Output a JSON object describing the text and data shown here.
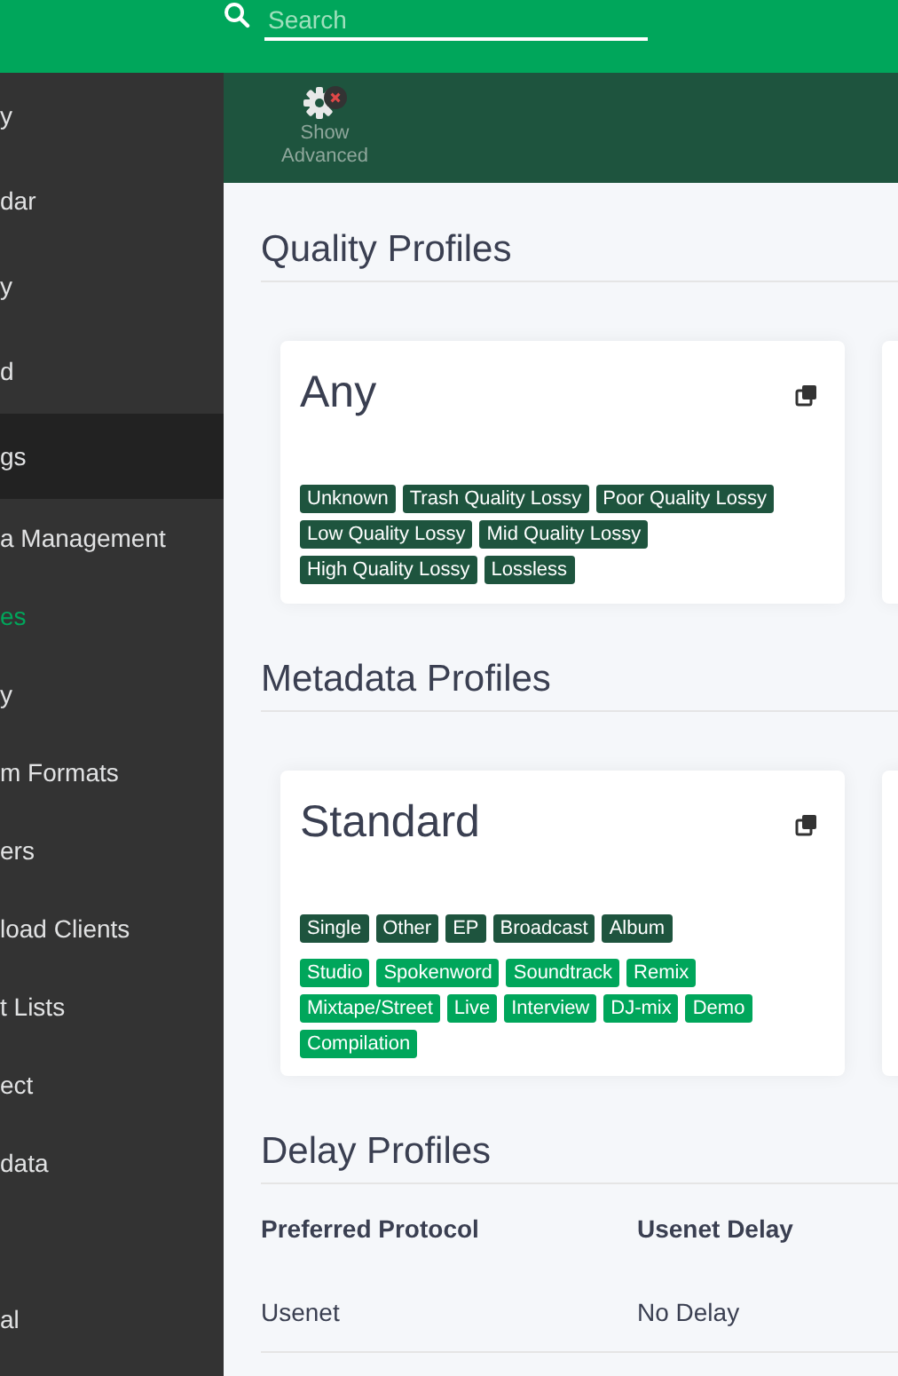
{
  "search": {
    "placeholder": "Search"
  },
  "sidebar": {
    "items": [
      {
        "label": "y",
        "kind": "top",
        "selected": false
      },
      {
        "label": "dar",
        "kind": "top",
        "selected": false
      },
      {
        "label": "y",
        "kind": "top",
        "selected": false
      },
      {
        "label": "d",
        "kind": "top",
        "selected": false
      },
      {
        "label": "gs",
        "kind": "top",
        "selected": true
      },
      {
        "label": "a Management",
        "kind": "sub",
        "selected": false
      },
      {
        "label": "es",
        "kind": "sub",
        "selected": true
      },
      {
        "label": "y",
        "kind": "sub",
        "selected": false
      },
      {
        "label": "m Formats",
        "kind": "sub",
        "selected": false
      },
      {
        "label": "ers",
        "kind": "sub",
        "selected": false
      },
      {
        "label": "load Clients",
        "kind": "sub",
        "selected": false
      },
      {
        "label": "t Lists",
        "kind": "sub",
        "selected": false
      },
      {
        "label": "ect",
        "kind": "sub",
        "selected": false
      },
      {
        "label": "data",
        "kind": "sub",
        "selected": false
      },
      {
        "label": "al",
        "kind": "top",
        "selected": false
      }
    ]
  },
  "toolbar": {
    "buttons": [
      {
        "label": "Show Advanced"
      }
    ]
  },
  "quality_profiles": {
    "title": "Quality Profiles",
    "cards": [
      {
        "name": "Any",
        "tag_rows": [
          {
            "kind": "allowed",
            "tags": [
              "Unknown",
              "Trash Quality Lossy",
              "Poor Quality Lossy",
              "Low Quality Lossy",
              "Mid Quality Lossy",
              "High Quality Lossy",
              "Lossless"
            ]
          }
        ]
      }
    ]
  },
  "metadata_profiles": {
    "title": "Metadata Profiles",
    "cards": [
      {
        "name": "Standard",
        "tag_rows": [
          {
            "kind": "primary",
            "tags": [
              "Single",
              "Other",
              "EP",
              "Broadcast",
              "Album"
            ]
          },
          {
            "kind": "secondary",
            "tags": [
              "Studio",
              "Spokenword",
              "Soundtrack",
              "Remix",
              "Mixtape/Street",
              "Live",
              "Interview",
              "DJ-mix",
              "Demo",
              "Compilation"
            ]
          }
        ]
      }
    ]
  },
  "delay_profiles": {
    "title": "Delay Profiles",
    "columns": [
      "Preferred Protocol",
      "Usenet Delay"
    ],
    "rows": [
      [
        "Usenet",
        "No Delay"
      ]
    ]
  }
}
